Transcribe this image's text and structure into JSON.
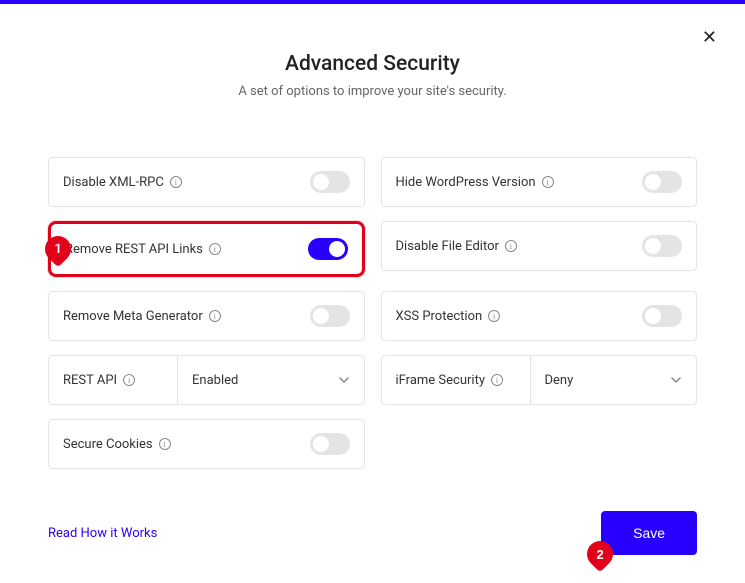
{
  "header": {
    "title": "Advanced Security",
    "subtitle": "A set of options to improve your site's security."
  },
  "options": {
    "left": [
      {
        "key": "disable-xml-rpc",
        "label": "Disable XML-RPC",
        "type": "toggle",
        "value": false
      },
      {
        "key": "remove-rest-api-links",
        "label": "Remove REST API Links",
        "type": "toggle",
        "value": true,
        "highlighted": true,
        "callout": "1"
      },
      {
        "key": "remove-meta-generator",
        "label": "Remove Meta Generator",
        "type": "toggle",
        "value": false
      },
      {
        "key": "rest-api",
        "label": "REST API",
        "type": "select",
        "value": "Enabled"
      },
      {
        "key": "secure-cookies",
        "label": "Secure Cookies",
        "type": "toggle",
        "value": false
      }
    ],
    "right": [
      {
        "key": "hide-wp-version",
        "label": "Hide WordPress Version",
        "type": "toggle",
        "value": false
      },
      {
        "key": "disable-file-editor",
        "label": "Disable File Editor",
        "type": "toggle",
        "value": false
      },
      {
        "key": "xss-protection",
        "label": "XSS Protection",
        "type": "toggle",
        "value": false
      },
      {
        "key": "iframe-security",
        "label": "iFrame Security",
        "type": "select",
        "value": "Deny"
      }
    ]
  },
  "footer": {
    "link_label": "Read How it Works",
    "save_label": "Save",
    "save_callout": "2"
  },
  "colors": {
    "accent": "#2800ff",
    "danger": "#e3001b",
    "border": "#e4e4e7"
  }
}
